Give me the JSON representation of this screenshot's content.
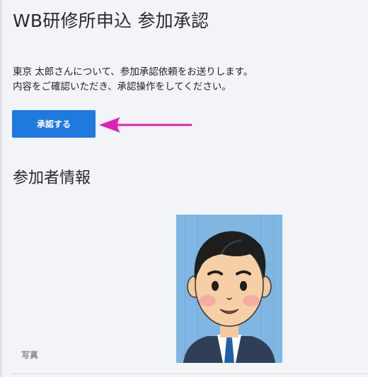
{
  "header": {
    "title": "WB研修所申込 参加承認"
  },
  "intro": {
    "line1": "東京 太郎さんについて、参加承認依頼をお送りします。",
    "line2": "内容をご確認いただき、承認操作をしてください。"
  },
  "actions": {
    "approve_label": "承認する"
  },
  "participant": {
    "section_title": "参加者情報",
    "photo_label": "写真"
  },
  "colors": {
    "primary_button": "#1f7ae0",
    "annotation_arrow": "#e21fb6",
    "photo_background": "#7fb6e2"
  }
}
